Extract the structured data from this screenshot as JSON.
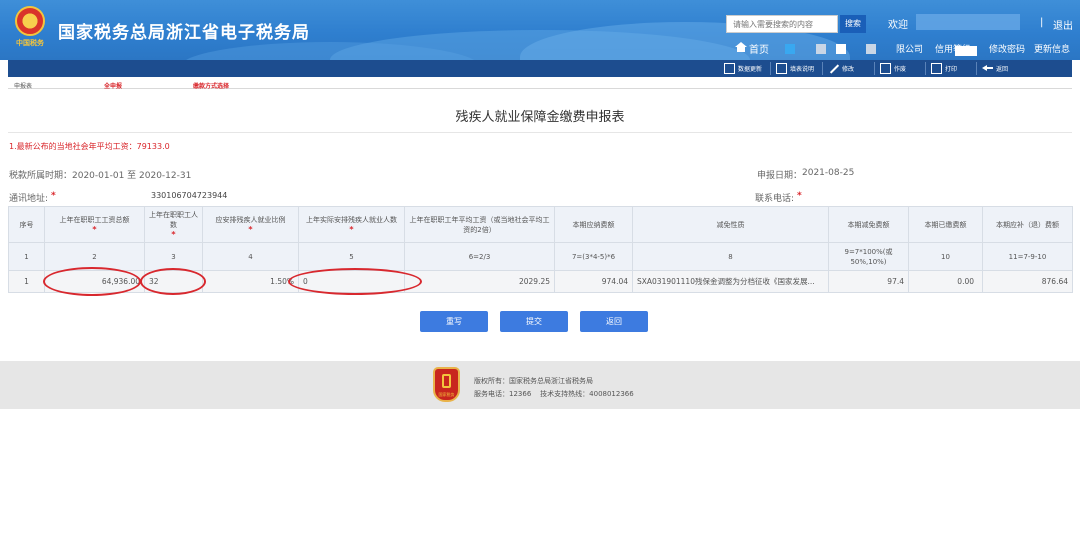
{
  "header": {
    "emblem_caption": "中国税务",
    "site_title": "国家税务总局浙江省电子税务局",
    "search_placeholder": "请输入需要搜索的内容",
    "search_button": "搜索",
    "welcome": "欢迎",
    "separator": "|",
    "logout": "退出",
    "home": "首页",
    "company_suffix": "限公司",
    "credit": "信用等级",
    "change_password": "修改密码",
    "update_info": "更新信息"
  },
  "toolbar": {
    "data_update": "数据更新",
    "fill_instructions": "填表说明",
    "edit": "修改",
    "void": "作废",
    "print": "打印",
    "back": "返回"
  },
  "subtabs": [
    "申报表",
    "全申报",
    "缴款方式选择"
  ],
  "form": {
    "title": "残疾人就业保障金缴费申报表",
    "notice": "1.最新公布的当地社会年平均工资：79133.0",
    "period_label": "税款所属时期：",
    "period_value": "2020-01-01 至 2020-12-31",
    "report_date_label": "申报日期：",
    "report_date_value": "2021-08-25",
    "address_label": "通讯地址:",
    "address_value": "330106704723944",
    "phone_label": "联系电话:",
    "required_mark": "*"
  },
  "table": {
    "headers": [
      "序号",
      "上年在职职工工资总额",
      "上年在职职工人数",
      "应安排残疾人就业比例",
      "上年实际安排残疾人就业人数",
      "上年在职职工年平均工资（或当地社会平均工资的2倍）",
      "本期应纳费额",
      "减免性质",
      "本期减免费额",
      "本期已缴费额",
      "本期应补（退）费额"
    ],
    "formula_row": [
      "1",
      "2",
      "3",
      "4",
      "5",
      "6=2/3",
      "7=(3*4-5)*6",
      "8",
      "9=7*100%(或50%,10%)",
      "10",
      "11=7-9-10"
    ],
    "data_row": [
      "1",
      "64,936.00",
      "32",
      "1.50%",
      "0",
      "2029.25",
      "974.04",
      "SXA031901110残保金调整为分档征收《国家发展...",
      "97.4",
      "0.00",
      "876.64"
    ]
  },
  "buttons": {
    "reset": "重写",
    "submit": "提交",
    "back": "返回"
  },
  "footer": {
    "logo_caption": "国家税务",
    "copyright": "版权所有：国家税务总局浙江省税务局",
    "service": "服务电话：12366    技术支持热线：4008012366"
  },
  "colors": {
    "header_blue": "#2f7fcf",
    "toolbar_navy": "#1d4d8f",
    "button_blue": "#3d7be0",
    "alert_red": "#d9262b"
  }
}
